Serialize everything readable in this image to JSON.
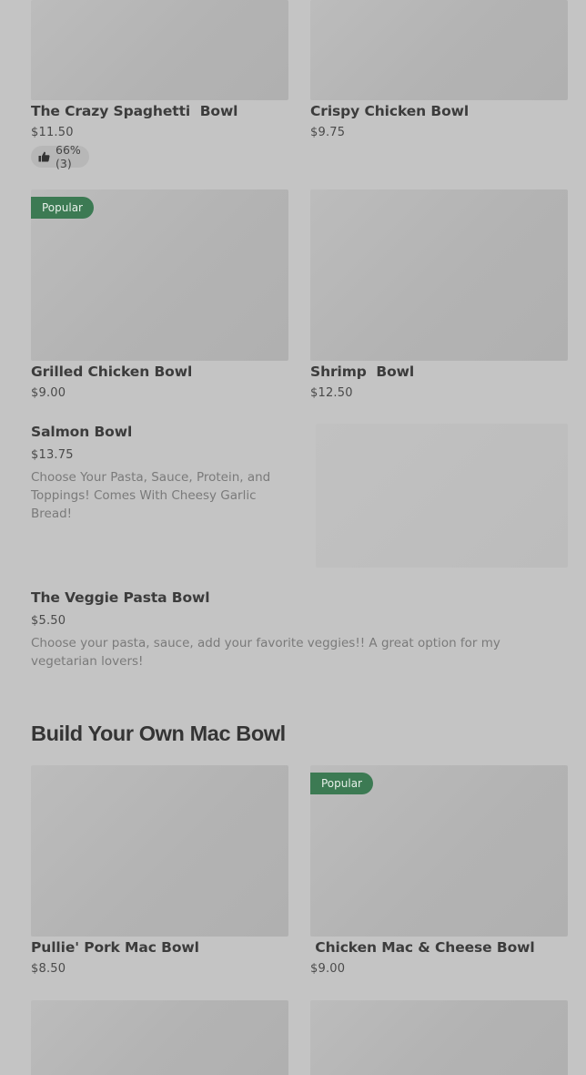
{
  "row1": {
    "left": {
      "name": "The Crazy Spaghetti  Bowl",
      "price": "$11.50",
      "rating": "66% (3)"
    },
    "right": {
      "name": "Crispy Chicken Bowl",
      "price": "$9.75"
    }
  },
  "row2": {
    "left": {
      "badge": "Popular",
      "name": "Grilled Chicken Bowl",
      "price": "$9.00"
    },
    "right": {
      "name": "Shrimp  Bowl",
      "price": "$12.50"
    }
  },
  "salmon": {
    "name": "Salmon Bowl",
    "price": "$13.75",
    "description": "Choose Your Pasta, Sauce, Protein, and Toppings! Comes With Cheesy Garlic Bread!"
  },
  "veggie": {
    "name": "The Veggie Pasta Bowl",
    "price": "$5.50",
    "description": "Choose your pasta, sauce, add your favorite veggies!! A great option for my vegetarian lovers!"
  },
  "section": {
    "title": "Build Your Own Mac Bowl"
  },
  "mac_row1": {
    "left": {
      "name": "Pullie' Pork Mac Bowl",
      "price": "$8.50"
    },
    "right": {
      "badge": "Popular",
      "name": " Chicken Mac & Cheese Bowl",
      "price": "$9.00"
    }
  },
  "icons": {
    "rating": "thumbs-up-icon"
  },
  "colors": {
    "badge": "#3c7a53",
    "background": "#c4c4c4"
  }
}
